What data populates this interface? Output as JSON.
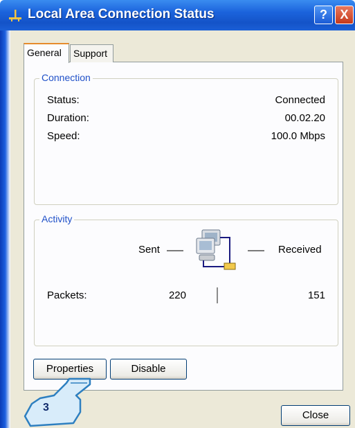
{
  "window": {
    "title": "Local Area Connection Status"
  },
  "titlebar_buttons": {
    "help": "?",
    "close": "X"
  },
  "tabs": [
    {
      "label": "General",
      "active": true
    },
    {
      "label": "Support",
      "active": false
    }
  ],
  "connection": {
    "legend": "Connection",
    "rows": [
      {
        "label": "Status:",
        "value": "Connected"
      },
      {
        "label": "Duration:",
        "value": "00.02.20"
      },
      {
        "label": "Speed:",
        "value": "100.0 Mbps"
      }
    ]
  },
  "activity": {
    "legend": "Activity",
    "sent_label": "Sent",
    "received_label": "Received",
    "packets_label": "Packets:",
    "packets_sent": "220",
    "packets_received": "151",
    "icon": "network-computers-icon"
  },
  "buttons": {
    "properties": "Properties",
    "disable": "Disable",
    "close": "Close"
  },
  "callout": {
    "number": "3",
    "icon": "pointing-hand-icon"
  },
  "colors": {
    "accent": "#1f50c8",
    "titlebar": "#1b63dc",
    "tab_highlight": "#e68b2c"
  }
}
